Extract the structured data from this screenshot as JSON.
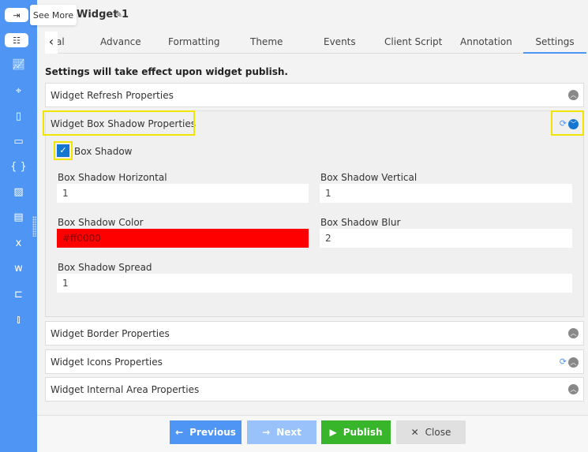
{
  "tooltip": "See More",
  "title": "Widget 1",
  "sidebar": {
    "icons": [
      "chart-icon",
      "map-icon",
      "report-icon",
      "id-card-icon",
      "braces-icon",
      "image-icon",
      "window-icon",
      "excel-icon",
      "word-icon",
      "tree-icon",
      "bar-chart-icon"
    ]
  },
  "tabs": [
    {
      "label": "al"
    },
    {
      "label": "Advance"
    },
    {
      "label": "Formatting"
    },
    {
      "label": "Theme"
    },
    {
      "label": "Events"
    },
    {
      "label": "Client Script"
    },
    {
      "label": "Annotation"
    },
    {
      "label": "Settings",
      "active": true
    }
  ],
  "notice": "Settings will take effect upon widget publish.",
  "panels": {
    "refresh": "Widget Refresh Properties",
    "shadow": "Widget Box Shadow Properties",
    "border": "Widget Border Properties",
    "icons": "Widget Icons Properties",
    "internal": "Widget Internal Area Properties"
  },
  "shadow": {
    "checkbox_label": "Box Shadow",
    "checked": true,
    "horizontal_label": "Box Shadow Horizontal",
    "horizontal": "1",
    "vertical_label": "Box Shadow Vertical",
    "vertical": "1",
    "color_label": "Box Shadow Color",
    "color": "#ff0000",
    "blur_label": "Box Shadow Blur",
    "blur": "2",
    "spread_label": "Box Shadow Spread",
    "spread": "1"
  },
  "buttons": {
    "previous": "Previous",
    "next": "Next",
    "publish": "Publish",
    "close": "Close"
  },
  "colors": {
    "sidebar": "#4f95f3",
    "publish": "#38b52a",
    "highlight": "#f0e400"
  }
}
